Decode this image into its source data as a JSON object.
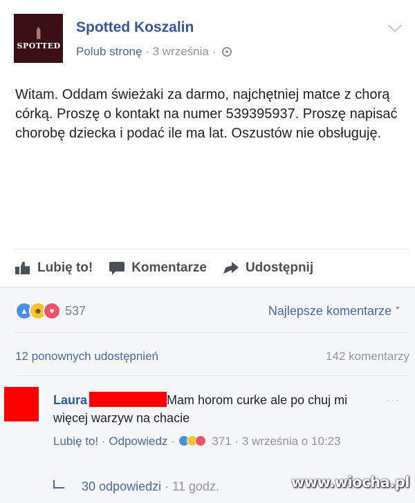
{
  "post": {
    "page_name": "Spotted Koszalin",
    "avatar_label": "SPOTTED",
    "like_page": "Polub stronę",
    "separator": "·",
    "date": "3 września",
    "text": "Witam. Oddam świeżaki za darmo, najchętniej matce z chorą córką. Proszę o kontakt na numer 539395937. Proszę napisać chorobę dziecka i podać ile ma lat. Oszustów nie obsługuję."
  },
  "actions": {
    "like": "Lubię to!",
    "comment": "Komentarze",
    "share": "Udostępnij"
  },
  "reactions": {
    "count": "537",
    "types": [
      "like",
      "haha",
      "love"
    ],
    "colors": {
      "like": "#4a90e2",
      "haha": "#f7c32e",
      "love": "#f25268"
    }
  },
  "sort": {
    "label": "Najlepsze komentarze"
  },
  "stats": {
    "shares": "12 ponownych udostępnień",
    "comments": "142 komentarzy"
  },
  "comment": {
    "author": "Laura",
    "text": "Mam horom curke ale po chuj mi więcej warzyw na chacie",
    "like_label": "Lubię to!",
    "reply_label": "Odpowiedz",
    "reaction_count": "371",
    "date": "3 września o 10:23",
    "replies_label": "30 odpowiedzi",
    "replies_time": "11 godz."
  },
  "watermark": "www.wiocha.pl",
  "colors": {
    "link": "#365899",
    "redaction": "#ff0000"
  }
}
